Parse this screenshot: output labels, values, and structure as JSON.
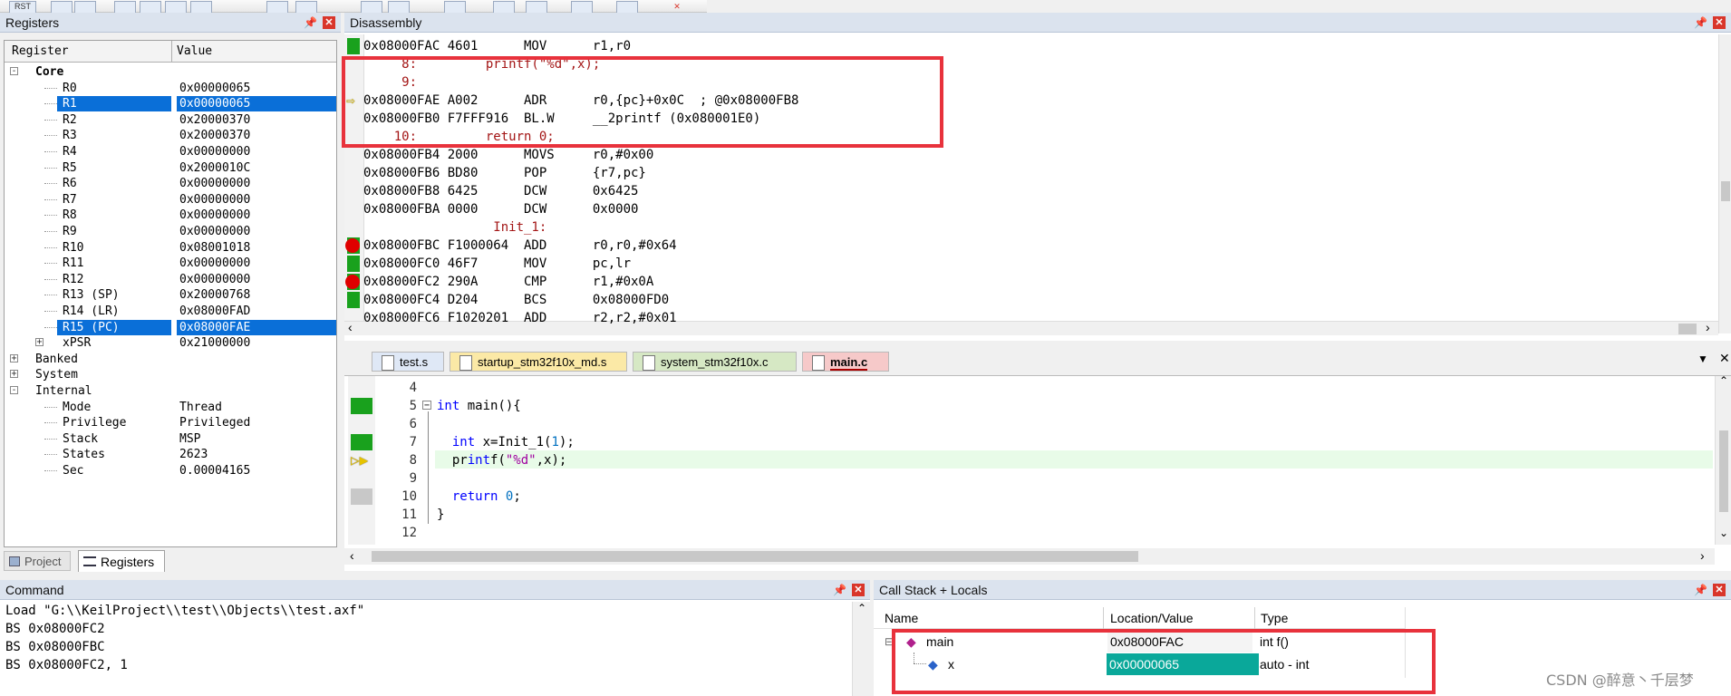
{
  "toolbar": {
    "rst_label": "RST"
  },
  "registers": {
    "title": "Registers",
    "col_register": "Register",
    "col_value": "Value",
    "core_label": "Core",
    "core_rows": [
      {
        "name": "R0",
        "value": "0x00000065",
        "selected": false
      },
      {
        "name": "R1",
        "value": "0x00000065",
        "selected": true
      },
      {
        "name": "R2",
        "value": "0x20000370",
        "selected": false
      },
      {
        "name": "R3",
        "value": "0x20000370",
        "selected": false
      },
      {
        "name": "R4",
        "value": "0x00000000",
        "selected": false
      },
      {
        "name": "R5",
        "value": "0x2000010C",
        "selected": false
      },
      {
        "name": "R6",
        "value": "0x00000000",
        "selected": false
      },
      {
        "name": "R7",
        "value": "0x00000000",
        "selected": false
      },
      {
        "name": "R8",
        "value": "0x00000000",
        "selected": false
      },
      {
        "name": "R9",
        "value": "0x00000000",
        "selected": false
      },
      {
        "name": "R10",
        "value": "0x08001018",
        "selected": false
      },
      {
        "name": "R11",
        "value": "0x00000000",
        "selected": false
      },
      {
        "name": "R12",
        "value": "0x00000000",
        "selected": false
      },
      {
        "name": "R13 (SP)",
        "value": "0x20000768",
        "selected": false
      },
      {
        "name": "R14 (LR)",
        "value": "0x08000FAD",
        "selected": false
      },
      {
        "name": "R15 (PC)",
        "value": "0x08000FAE",
        "selected": true
      }
    ],
    "xpsr": {
      "name": "xPSR",
      "value": "0x21000000"
    },
    "groups": [
      "Banked",
      "System",
      "Internal"
    ],
    "internal_rows": [
      {
        "name": "Mode",
        "value": "Thread"
      },
      {
        "name": "Privilege",
        "value": "Privileged"
      },
      {
        "name": "Stack",
        "value": "MSP"
      },
      {
        "name": "States",
        "value": "2623"
      },
      {
        "name": "Sec",
        "value": "0.00004165"
      }
    ],
    "tab_project": "Project",
    "tab_registers": "Registers"
  },
  "disassembly": {
    "title": "Disassembly",
    "lines": [
      {
        "text": "0x08000FAC 4601      MOV      r1,r0",
        "kind": "asm",
        "marker": "green"
      },
      {
        "text": "     8:         printf(\"%d\",x);",
        "kind": "src",
        "marker": "none"
      },
      {
        "text": "     9:",
        "kind": "src",
        "marker": "none"
      },
      {
        "text": "0x08000FAE A002      ADR      r0,{pc}+0x0C  ; @0x08000FB8",
        "kind": "asm",
        "marker": "arrow"
      },
      {
        "text": "0x08000FB0 F7FFF916  BL.W     __2printf (0x080001E0)",
        "kind": "asm",
        "marker": "none"
      },
      {
        "text": "    10:         return 0;",
        "kind": "src",
        "marker": "none"
      },
      {
        "text": "0x08000FB4 2000      MOVS     r0,#0x00",
        "kind": "asm",
        "marker": "none"
      },
      {
        "text": "0x08000FB6 BD80      POP      {r7,pc}",
        "kind": "asm",
        "marker": "none"
      },
      {
        "text": "0x08000FB8 6425      DCW      0x6425",
        "kind": "asm",
        "marker": "none"
      },
      {
        "text": "0x08000FBA 0000      DCW      0x0000",
        "kind": "asm",
        "marker": "none"
      },
      {
        "text": "                 Init_1:",
        "kind": "src",
        "marker": "none"
      },
      {
        "text": "0x08000FBC F1000064  ADD      r0,r0,#0x64",
        "kind": "asm",
        "marker": "bp"
      },
      {
        "text": "0x08000FC0 46F7      MOV      pc,lr",
        "kind": "asm",
        "marker": "green"
      },
      {
        "text": "0x08000FC2 290A      CMP      r1,#0x0A",
        "kind": "asm",
        "marker": "bp"
      },
      {
        "text": "0x08000FC4 D204      BCS      0x08000FD0",
        "kind": "asm",
        "marker": "green"
      },
      {
        "text": "0x08000FC6 F1020201  ADD      r2,r2,#0x01",
        "kind": "asm",
        "marker": "none"
      }
    ]
  },
  "editor": {
    "tabs": [
      {
        "label": "test.s",
        "color": "#dfe8f6",
        "active": false
      },
      {
        "label": "startup_stm32f10x_md.s",
        "color": "#fbe9a6",
        "active": false
      },
      {
        "label": "system_stm32f10x.c",
        "color": "#d6e8c4",
        "active": false
      },
      {
        "label": "main.c",
        "color": "#f6c9c9",
        "active": true
      }
    ],
    "lines": [
      {
        "num": "4",
        "code": "",
        "marker": "none"
      },
      {
        "num": "5",
        "code": "int main(){",
        "marker": "green"
      },
      {
        "num": "6",
        "code": "",
        "marker": "none"
      },
      {
        "num": "7",
        "code": "  int x=Init_1(1);",
        "marker": "green"
      },
      {
        "num": "8",
        "code": "  printf(\"%d\",x);",
        "marker": "arrow"
      },
      {
        "num": "9",
        "code": "",
        "marker": "none"
      },
      {
        "num": "10",
        "code": "  return 0;",
        "marker": "gray"
      },
      {
        "num": "11",
        "code": "}",
        "marker": "none"
      },
      {
        "num": "12",
        "code": "",
        "marker": "none"
      }
    ]
  },
  "command": {
    "title": "Command",
    "lines": [
      "Load \"G:\\\\KeilProject\\\\test\\\\Objects\\\\test.axf\"",
      "BS 0x08000FC2",
      "BS 0x08000FBC",
      "BS 0x08000FC2, 1"
    ]
  },
  "callstack": {
    "title": "Call Stack + Locals",
    "col_name": "Name",
    "col_location": "Location/Value",
    "col_type": "Type",
    "rows": [
      {
        "name": "main",
        "value": "0x08000FAC",
        "type": "int f()"
      },
      {
        "name": "x",
        "value": "0x00000065",
        "type": "auto - int"
      }
    ]
  },
  "watermark": "CSDN @醉意丶千层梦",
  "colors": {
    "selection": "#0a6fd8",
    "highlight_box": "#e8323c",
    "local_value_bg": "#0aa89a"
  }
}
